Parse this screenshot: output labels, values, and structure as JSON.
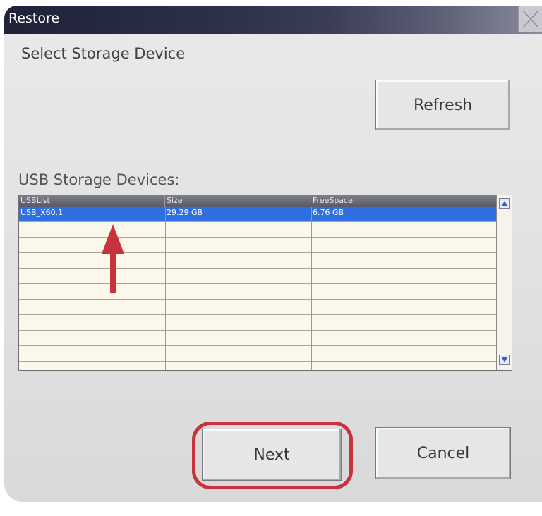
{
  "window": {
    "title": "Restore",
    "close_icon": "close-icon"
  },
  "section_title": "Select Storage Device",
  "buttons": {
    "refresh": "Refresh",
    "next": "Next",
    "cancel": "Cancel"
  },
  "usb_label": "USB Storage Devices:",
  "table": {
    "columns": [
      "USBList",
      "Size",
      "FreeSpace"
    ],
    "rows": [
      {
        "usb": "USB_X60.1",
        "size": "29.29 GB",
        "free": "6.76 GB",
        "selected": true
      }
    ],
    "empty_rows": 9
  },
  "scrollbar": {
    "up_icon": "scroll-up-arrow-icon",
    "down_icon": "scroll-down-arrow-icon"
  },
  "annotations": {
    "arrow_icon": "red-up-arrow-icon",
    "ring": "red-highlight-ring",
    "color": "#c8323b"
  },
  "colors": {
    "selection": "#2f6fe0",
    "titlebar": "#2c3049",
    "grid_bg": "#fbf8eb"
  }
}
